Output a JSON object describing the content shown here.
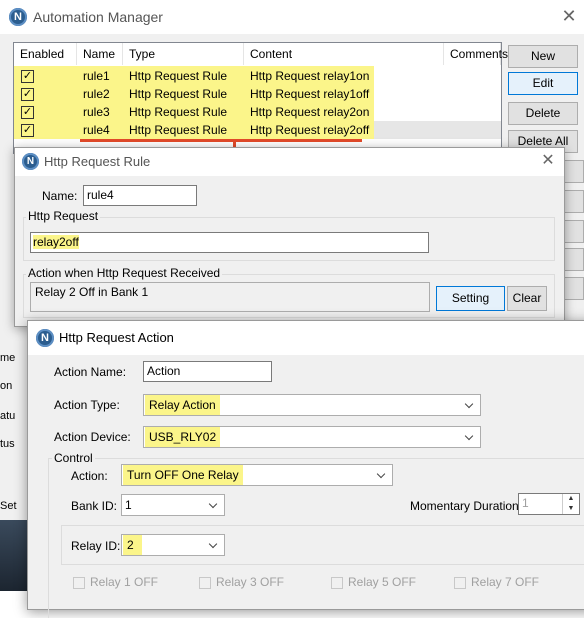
{
  "main_window": {
    "title": "Automation Manager",
    "close_glyph": "✕",
    "table": {
      "headers": [
        "Enabled",
        "Name",
        "Type",
        "Content",
        "Comments"
      ],
      "rows": [
        {
          "enabled": true,
          "name": "rule1",
          "type": "Http Request Rule",
          "content": "Http Request relay1on",
          "comments": ""
        },
        {
          "enabled": true,
          "name": "rule2",
          "type": "Http Request Rule",
          "content": "Http Request relay1off",
          "comments": ""
        },
        {
          "enabled": true,
          "name": "rule3",
          "type": "Http Request Rule",
          "content": "Http Request relay2on",
          "comments": ""
        },
        {
          "enabled": true,
          "name": "rule4",
          "type": "Http Request Rule",
          "content": "Http Request relay2off",
          "comments": ""
        }
      ]
    },
    "buttons": {
      "new": "New",
      "edit": "Edit",
      "delete": "Delete",
      "delete_all": "Delete All"
    },
    "left_edge_fragments": [
      "me",
      "on",
      "atu",
      "tus",
      "Set"
    ]
  },
  "rule_dialog": {
    "title": "Http Request Rule",
    "close_glyph": "✕",
    "name_label": "Name:",
    "name_value": "rule4",
    "http_request_group": "Http Request",
    "http_request_value": "relay2off",
    "action_group": "Action when Http Request Received",
    "action_summary": "Relay 2 Off in Bank 1",
    "setting_button": "Setting",
    "clear_button": "Clear"
  },
  "action_dialog": {
    "title": "Http Request Action",
    "action_name_label": "Action Name:",
    "action_name_value": "Action",
    "action_type_label": "Action Type:",
    "action_type_value": "Relay Action",
    "action_device_label": "Action Device:",
    "action_device_value": "USB_RLY02",
    "control_group": "Control",
    "action_label": "Action:",
    "action_value": "Turn OFF One Relay",
    "bank_id_label": "Bank ID:",
    "bank_id_value": "1",
    "momentary_label": "Momentary Duration:",
    "momentary_value": "1",
    "relay_id_label": "Relay ID:",
    "relay_id_value": "2",
    "relay_checkboxes": [
      "Relay 1  OFF",
      "Relay 3  OFF",
      "Relay 5  OFF",
      "Relay 7  OFF"
    ]
  },
  "colors": {
    "highlight": "#fbf58a",
    "arrow": "#e24a2a",
    "accent": "#0078d7",
    "logo": "#2b5d8f"
  }
}
